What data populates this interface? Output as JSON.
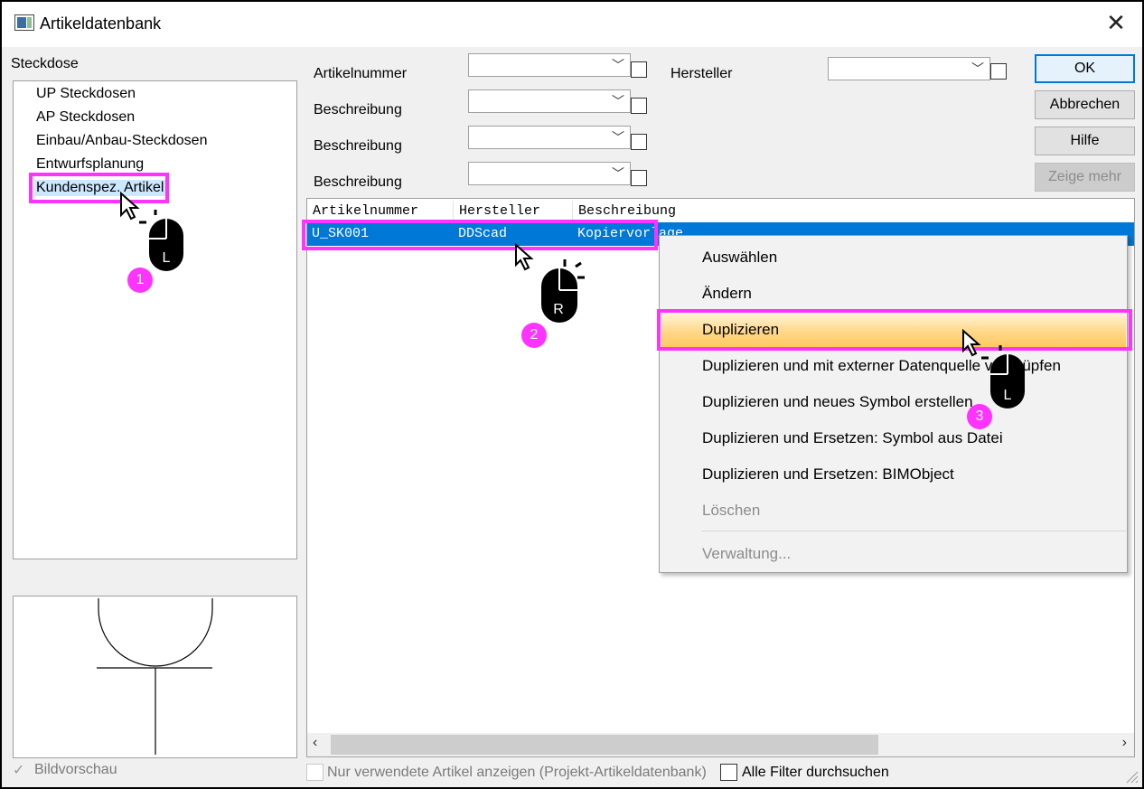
{
  "window": {
    "title": "Artikeldatenbank"
  },
  "tree": {
    "header": "Steckdose",
    "items": [
      {
        "label": "UP Steckdosen"
      },
      {
        "label": "AP Steckdosen"
      },
      {
        "label": "Einbau/Anbau-Steckdosen"
      },
      {
        "label": "Entwurfsplanung"
      },
      {
        "label": "Kundenspez. Artikel",
        "selected": true
      }
    ]
  },
  "filters": {
    "artikelnummer_label": "Artikelnummer",
    "beschreibung_label_1": "Beschreibung",
    "beschreibung_label_2": "Beschreibung",
    "beschreibung_label_3": "Beschreibung",
    "hersteller_label": "Hersteller"
  },
  "buttons": {
    "ok": "OK",
    "abbrechen": "Abbrechen",
    "hilfe": "Hilfe",
    "zeige_mehr": "Zeige mehr"
  },
  "table": {
    "columns": [
      "Artikelnummer",
      "Hersteller",
      "Beschreibung"
    ],
    "rows": [
      {
        "artikelnummer": "U_SK001",
        "hersteller": "DDScad",
        "beschreibung": "Kopiervorlage"
      }
    ]
  },
  "context_menu": {
    "items": [
      {
        "label": "Auswählen",
        "enabled": true
      },
      {
        "label": "Ändern",
        "enabled": true
      },
      {
        "label": "Duplizieren",
        "enabled": true,
        "highlighted": true
      },
      {
        "label": "Duplizieren und mit externer Datenquelle verknüpfen",
        "enabled": true
      },
      {
        "label": "Duplizieren und neues Symbol erstellen",
        "enabled": true
      },
      {
        "label": "Duplizieren und Ersetzen: Symbol aus Datei",
        "enabled": true
      },
      {
        "label": "Duplizieren und Ersetzen: BIMObject",
        "enabled": true
      },
      {
        "label": "Löschen",
        "enabled": false
      },
      {
        "label": "Verwaltung...",
        "enabled": false
      }
    ]
  },
  "bottom": {
    "bildvorschau": "Bildvorschau",
    "nur_verwendete": "Nur verwendete Artikel anzeigen (Projekt-Artikeldatenbank)",
    "alle_filter": "Alle Filter durchsuchen"
  },
  "annotations": {
    "step1": "1",
    "step2": "2",
    "step3": "3",
    "mouse_left": "L",
    "mouse_right": "R"
  },
  "colors": {
    "highlight_box": "#ff33ff",
    "selection": "#0078d7",
    "menu_hover": "#ffd88a"
  }
}
